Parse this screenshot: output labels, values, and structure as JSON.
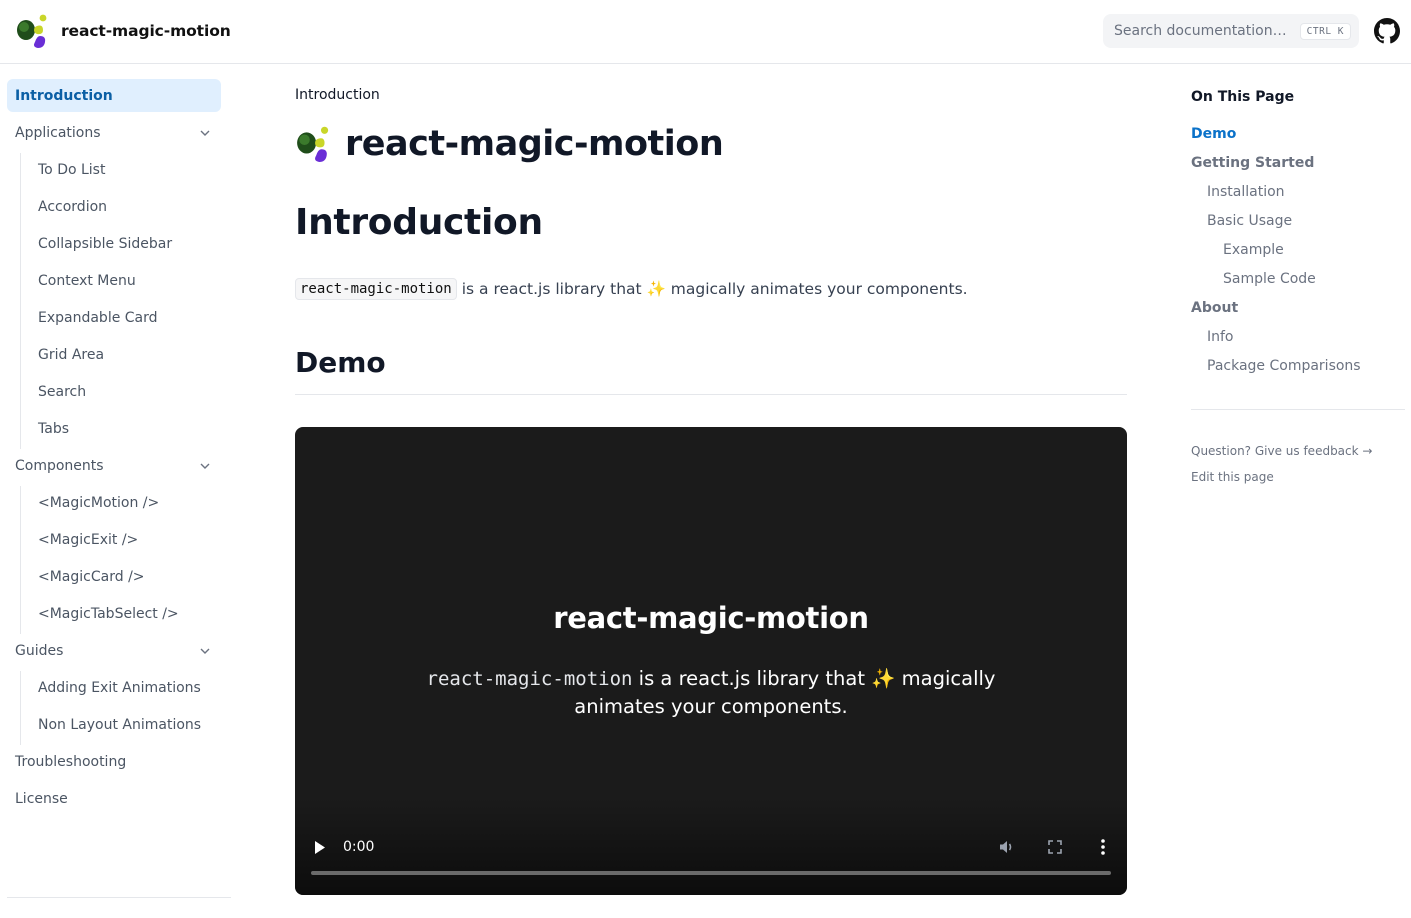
{
  "header": {
    "brand_name": "react-magic-motion",
    "search_placeholder": "Search documentation…",
    "search_shortcut": "CTRL K"
  },
  "sidebar": {
    "introduction": "Introduction",
    "applications": "Applications",
    "applications_items": [
      "To Do List",
      "Accordion",
      "Collapsible Sidebar",
      "Context Menu",
      "Expandable Card",
      "Grid Area",
      "Search",
      "Tabs"
    ],
    "components": "Components",
    "components_items": [
      "<MagicMotion />",
      "<MagicExit />",
      "<MagicCard />",
      "<MagicTabSelect />"
    ],
    "guides": "Guides",
    "guides_items": [
      "Adding Exit Animations",
      "Non Layout Animations"
    ],
    "troubleshooting": "Troubleshooting",
    "license": "License"
  },
  "main": {
    "breadcrumb": "Introduction",
    "title": "react-magic-motion",
    "heading": "Introduction",
    "intro_code": "react-magic-motion",
    "intro_text": "is a react.js library that ✨ magically animates your components.",
    "demo_heading": "Demo",
    "video": {
      "title": "react-magic-motion",
      "desc_code": "react-magic-motion",
      "desc_text": " is a react.js library that ✨ magically animates your components.",
      "time": "0:00",
      "progress": 0
    }
  },
  "toc": {
    "title": "On This Page",
    "items": [
      {
        "label": "Demo",
        "level": 1,
        "active": true
      },
      {
        "label": "Getting Started",
        "level": 1,
        "active": false
      },
      {
        "label": "Installation",
        "level": 2,
        "active": false
      },
      {
        "label": "Basic Usage",
        "level": 2,
        "active": false
      },
      {
        "label": "Example",
        "level": 3,
        "active": false
      },
      {
        "label": "Sample Code",
        "level": 3,
        "active": false
      },
      {
        "label": "About",
        "level": 1,
        "active": false
      },
      {
        "label": "Info",
        "level": 2,
        "active": false
      },
      {
        "label": "Package Comparisons",
        "level": 2,
        "active": false
      }
    ],
    "feedback": "Question? Give us feedback →",
    "edit": "Edit this page"
  },
  "colors": {
    "accent": "#0b72c9",
    "active_bg": "#e0effe",
    "logo_green": "#1f4d1a",
    "logo_yellow": "#c9d629",
    "logo_purple": "#6a2ed6"
  },
  "icons": [
    "logo-icon",
    "chevron-down-icon",
    "github-icon",
    "play-icon",
    "volume-icon",
    "fullscreen-icon",
    "more-vert-icon"
  ]
}
